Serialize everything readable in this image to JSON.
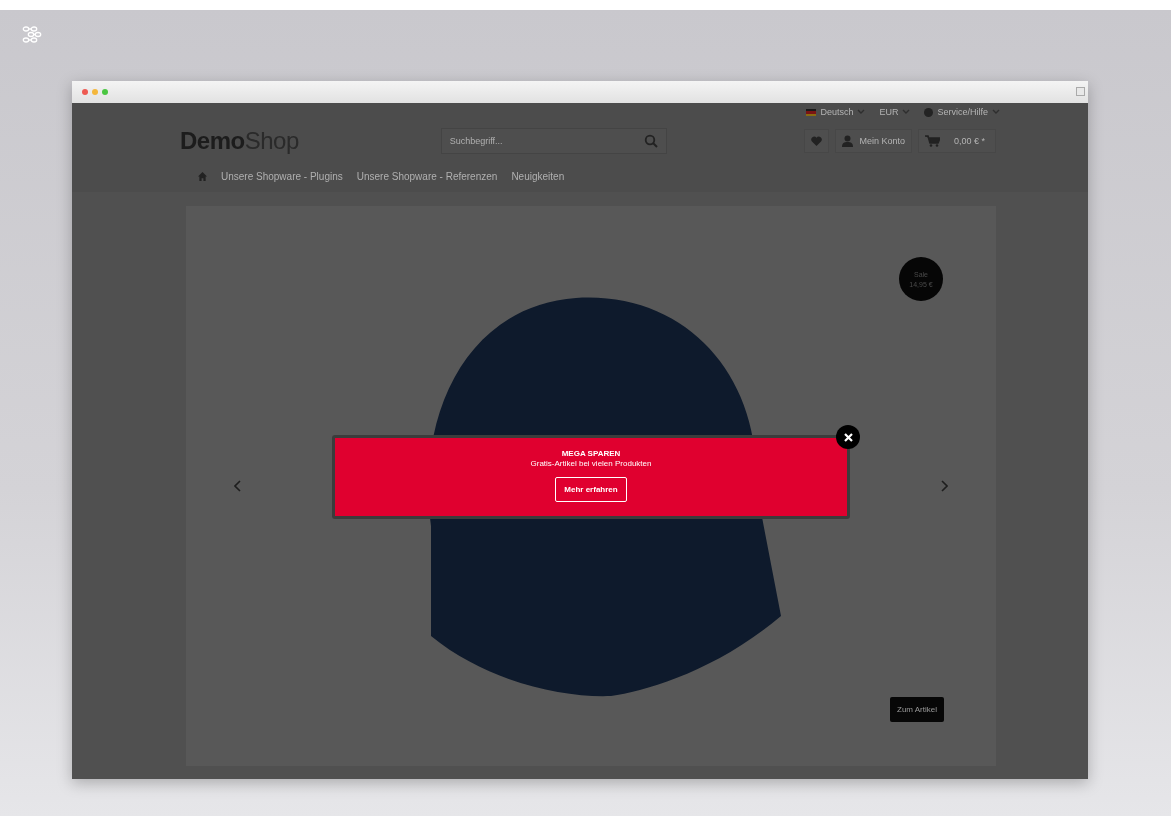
{
  "top_bar": {
    "language": "Deutsch",
    "currency": "EUR",
    "service": "Service/Hilfe"
  },
  "header": {
    "logo_bold": "Demo",
    "logo_light": "Shop",
    "search": {
      "placeholder": "Suchbegriff..."
    },
    "account": "Mein Konto",
    "cart_total": "0,00 € *"
  },
  "nav": {
    "items": [
      {
        "label": "Unsere Shopware - Plugins"
      },
      {
        "label": "Unsere Shopware - Referenzen"
      },
      {
        "label": "Neuigkeiten"
      }
    ]
  },
  "slider": {
    "badge": {
      "label": "Sale",
      "price": "14,95 €"
    },
    "button": "Zum Artikel"
  },
  "popup": {
    "title": "MEGA SPAREN",
    "text": "Gratis-Artikel bei vielen Produkten",
    "button": "Mehr erfahren"
  }
}
